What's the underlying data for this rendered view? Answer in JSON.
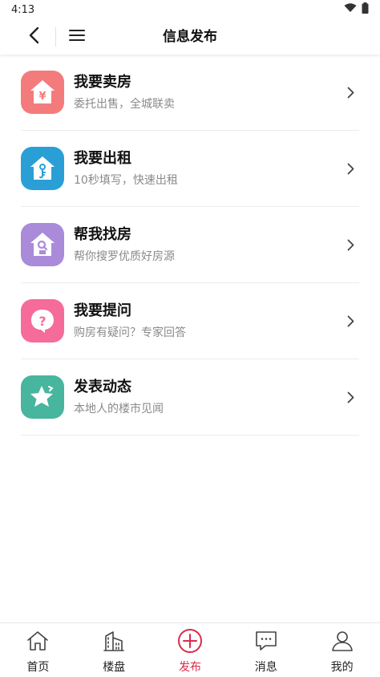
{
  "status": {
    "time": "4:13"
  },
  "header": {
    "title": "信息发布"
  },
  "items": [
    {
      "title": "我要卖房",
      "subtitle": "委托出售，全城联卖",
      "icon": "sell-house-icon",
      "color": "#f47b7b"
    },
    {
      "title": "我要出租",
      "subtitle": "10秒填写，快速出租",
      "icon": "rent-house-icon",
      "color": "#2a9fd6"
    },
    {
      "title": "帮我找房",
      "subtitle": "帮你搜罗优质好房源",
      "icon": "find-house-icon",
      "color": "#a98bd9"
    },
    {
      "title": "我要提问",
      "subtitle": "购房有疑问？专家回答",
      "icon": "question-icon",
      "color": "#f56c9b"
    },
    {
      "title": "发表动态",
      "subtitle": "本地人的楼市见闻",
      "icon": "star-post-icon",
      "color": "#48b59e"
    }
  ],
  "tabs": [
    {
      "label": "首页",
      "icon": "home-icon"
    },
    {
      "label": "楼盘",
      "icon": "buildings-icon"
    },
    {
      "label": "发布",
      "icon": "plus-circle-icon",
      "active": true
    },
    {
      "label": "消息",
      "icon": "message-icon"
    },
    {
      "label": "我的",
      "icon": "user-icon"
    }
  ],
  "colors": {
    "accent": "#d92b4b",
    "divider": "#ececec"
  }
}
